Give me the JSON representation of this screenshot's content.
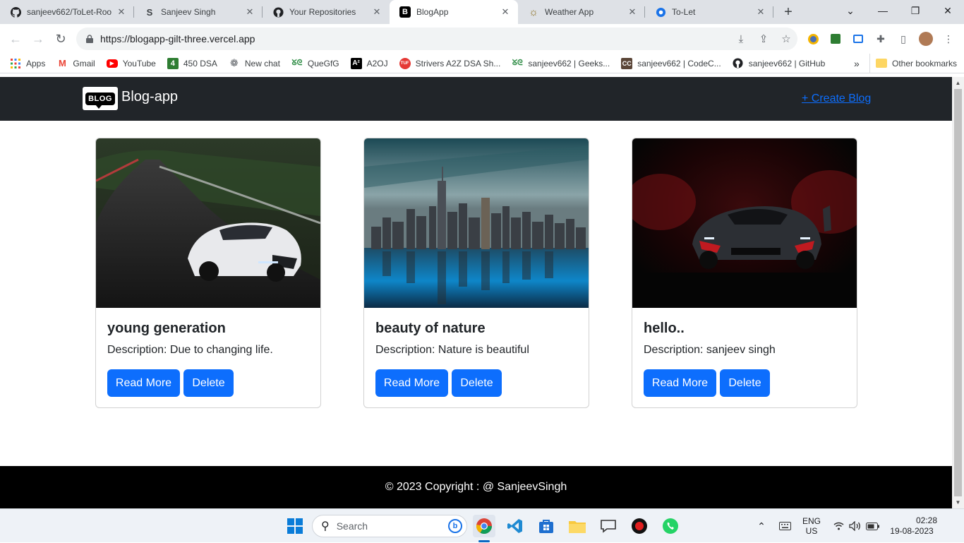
{
  "browser": {
    "tabs": [
      {
        "title": "sanjeev662/ToLet-Roo",
        "icon": "github-icon",
        "active": false
      },
      {
        "title": "Sanjeev Singh",
        "icon": "s-logo-icon",
        "active": false
      },
      {
        "title": "Your Repositories",
        "icon": "github-icon",
        "active": false
      },
      {
        "title": "BlogApp",
        "icon": "b-logo-icon",
        "active": true
      },
      {
        "title": "Weather App",
        "icon": "sun-icon",
        "active": false
      },
      {
        "title": "To-Let",
        "icon": "globe-icon",
        "active": false
      }
    ],
    "new_tab": "+",
    "url": "https://blogapp-gilt-three.vercel.app",
    "bookmarks": [
      {
        "label": "Apps",
        "icon": "apps-grid-icon"
      },
      {
        "label": "Gmail",
        "icon": "gmail-icon"
      },
      {
        "label": "YouTube",
        "icon": "youtube-icon"
      },
      {
        "label": "450 DSA",
        "icon": "number-4-icon"
      },
      {
        "label": "New chat",
        "icon": "chatgpt-icon"
      },
      {
        "label": "QueGfG",
        "icon": "gfg-icon"
      },
      {
        "label": "A2OJ",
        "icon": "a2oj-icon"
      },
      {
        "label": "Strivers A2Z DSA Sh...",
        "icon": "tuf-icon"
      },
      {
        "label": "sanjeev662 | Geeks...",
        "icon": "gfg-icon"
      },
      {
        "label": "sanjeev662 | CodeC...",
        "icon": "codechef-icon"
      },
      {
        "label": "sanjeev662 | GitHub",
        "icon": "github-icon"
      }
    ],
    "bookmarks_overflow": "»",
    "other_bookmarks": "Other bookmarks"
  },
  "site": {
    "logo_text": "BLOG",
    "brand": "Blog-app",
    "create_link": "+ Create Blog",
    "cards": [
      {
        "title": "young generation",
        "description": "Description: Due to changing life.",
        "read_more": "Read More",
        "delete": "Delete",
        "image": "white-sports-car-on-road"
      },
      {
        "title": "beauty of nature",
        "description": "Description: Nature is beautiful",
        "read_more": "Read More",
        "delete": "Delete",
        "image": "city-skyline-reflection"
      },
      {
        "title": "hello..",
        "description": "Description: sanjeev singh",
        "read_more": "Read More",
        "delete": "Delete",
        "image": "dark-supercar-red-smoke"
      }
    ],
    "footer": "© 2023 Copyright : @ SanjeevSingh"
  },
  "taskbar": {
    "search_placeholder": "Search",
    "lang_top": "ENG",
    "lang_bottom": "US",
    "time": "02:28",
    "date": "19-08-2023"
  },
  "colors": {
    "primary": "#0d6efd",
    "navbar": "#212529",
    "footer": "#000000"
  }
}
